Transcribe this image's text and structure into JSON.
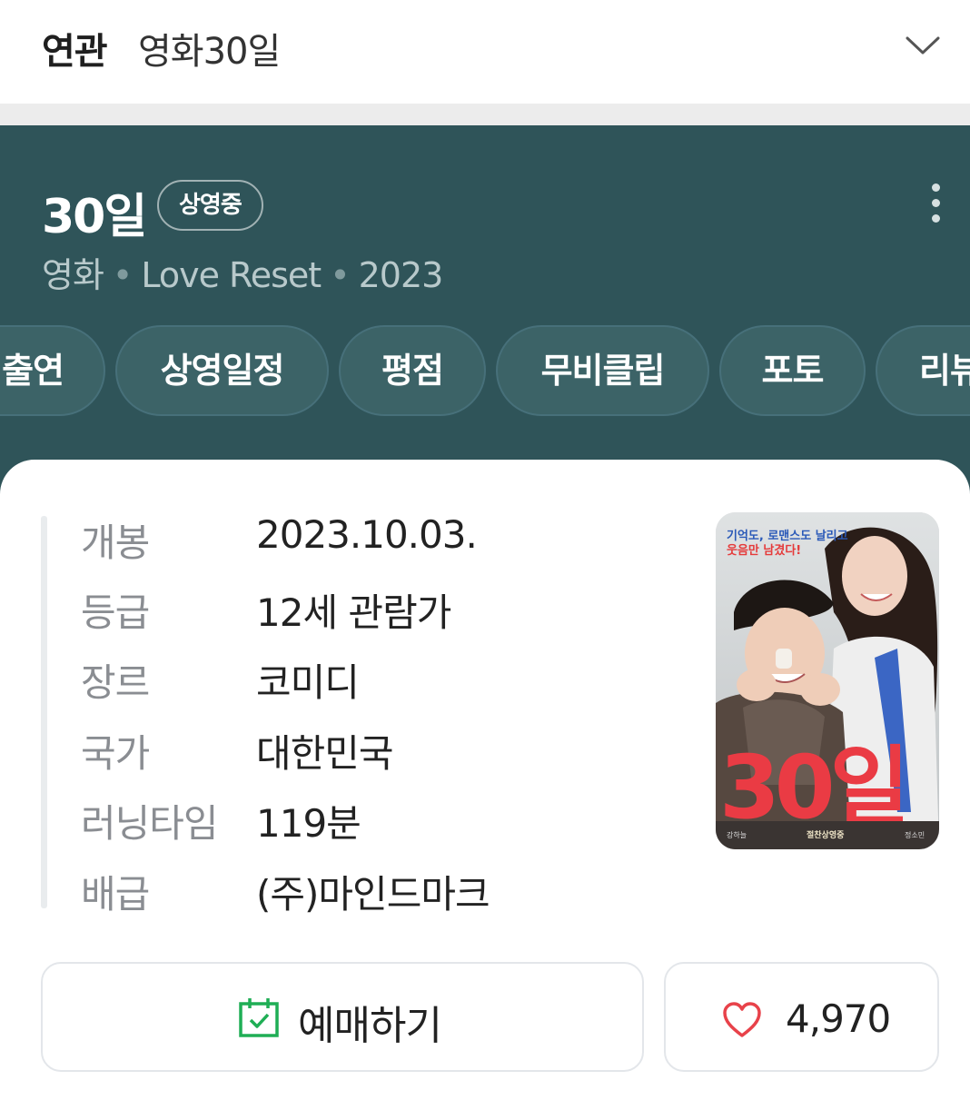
{
  "related": {
    "label": "연관",
    "term": "영화30일",
    "chevron_icon": "chevron-down-icon"
  },
  "movie": {
    "title": "30일",
    "badge": "상영중",
    "more_icon": "more-vertical-icon",
    "meta": {
      "category": "영화",
      "english_title": "Love Reset",
      "year": "2023"
    }
  },
  "tabs": [
    {
      "label": "출연"
    },
    {
      "label": "상영일정"
    },
    {
      "label": "평점"
    },
    {
      "label": "무비클립"
    },
    {
      "label": "포토"
    },
    {
      "label": "리뷰"
    }
  ],
  "info": [
    {
      "key": "개봉",
      "value": "2023.10.03."
    },
    {
      "key": "등급",
      "value": "12세 관람가"
    },
    {
      "key": "장르",
      "value": "코미디"
    },
    {
      "key": "국가",
      "value": "대한민국"
    },
    {
      "key": "러닝타임",
      "value": "119분"
    },
    {
      "key": "배급",
      "value": "(주)마인드마크"
    }
  ],
  "poster": {
    "tagline_line1": "기억도, 로맨스도 날리고",
    "tagline_line2": "웃음만 남겼다!",
    "title_text": "30일",
    "credit_left": "강하늘",
    "credit_center": "절찬상영중",
    "credit_right": "정소민"
  },
  "actions": {
    "book_label": "예매하기",
    "book_icon": "calendar-check-icon",
    "like_count": "4,970",
    "like_icon": "heart-icon"
  },
  "colors": {
    "hero_bg": "#2f5459",
    "tab_bg": "#3c6367",
    "book_icon": "#1fae55",
    "heart": "#e8424a"
  }
}
